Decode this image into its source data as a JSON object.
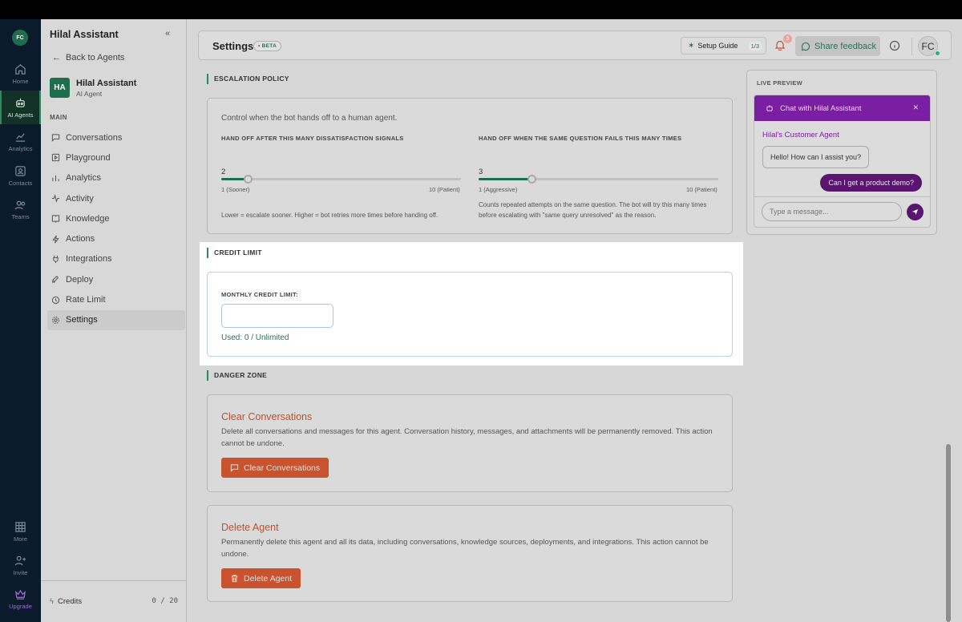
{
  "rail": {
    "avatar": "FC",
    "items": [
      {
        "label": "Home",
        "icon": "home-icon"
      },
      {
        "label": "AI Agents",
        "icon": "robot-icon"
      },
      {
        "label": "Analytics",
        "icon": "chart-icon"
      },
      {
        "label": "Contacts",
        "icon": "contacts-icon"
      },
      {
        "label": "Teams",
        "icon": "teams-icon"
      },
      {
        "label": "More",
        "icon": "grid-icon"
      },
      {
        "label": "Invite",
        "icon": "user-plus-icon"
      },
      {
        "label": "Upgrade",
        "icon": "crown-icon"
      }
    ]
  },
  "sidebar": {
    "title": "Hilal Assistant",
    "back": "Back to Agents",
    "agent": {
      "initials": "HA",
      "name": "Hilal Assistant",
      "type": "AI Agent"
    },
    "section": "MAIN",
    "items": [
      {
        "label": "Conversations"
      },
      {
        "label": "Playground"
      },
      {
        "label": "Analytics"
      },
      {
        "label": "Activity"
      },
      {
        "label": "Knowledge"
      },
      {
        "label": "Actions"
      },
      {
        "label": "Integrations"
      },
      {
        "label": "Deploy"
      },
      {
        "label": "Rate Limit"
      },
      {
        "label": "Settings"
      }
    ],
    "credits_label": "Credits",
    "credits_value": "0 / 20"
  },
  "header": {
    "title": "Settings",
    "badge": "• BETA",
    "setup_label": "Setup Guide",
    "setup_step": "1/3",
    "notification_count": "3",
    "feedback_label": "Share feedback",
    "avatar": "FC"
  },
  "escalation": {
    "heading": "ESCALATION POLICY",
    "description": "Control when the bot hands off to a human agent.",
    "slider1": {
      "label": "HAND OFF AFTER THIS MANY DISSATISFACTION SIGNALS",
      "value": "2",
      "min_label": "1 (Sooner)",
      "max_label": "10 (Patient)",
      "hint": "Lower = escalate sooner. Higher = bot retries more times before handing off.",
      "fraction": 0.111
    },
    "slider2": {
      "label": "HAND OFF WHEN THE SAME QUESTION FAILS THIS MANY TIMES",
      "value": "3",
      "min_label": "1 (Aggressive)",
      "max_label": "10 (Patient)",
      "hint": "Counts repeated attempts on the same question. The bot will try this many times before escalating with \"same query unresolved\" as the reason.",
      "fraction": 0.222
    }
  },
  "credit": {
    "heading": "CREDIT LIMIT",
    "label": "MONTHLY CREDIT LIMIT:",
    "input_value": "",
    "used": "Used: 0 / Unlimited"
  },
  "danger": {
    "heading": "DANGER ZONE",
    "clear": {
      "title": "Clear Conversations",
      "description": "Delete all conversations and messages for this agent. Conversation history, messages, and attachments will be permanently removed. This action cannot be undone.",
      "button": "Clear Conversations"
    },
    "delete": {
      "title": "Delete Agent",
      "description": "Permanently delete this agent and all its data, including conversations, knowledge sources, deployments, and integrations. This action cannot be undone.",
      "button": "Delete Agent"
    }
  },
  "preview": {
    "label": "LIVE PREVIEW",
    "chat_title": "Chat with Hilal Assistant",
    "agent_name": "Hilal's Customer Agent",
    "bot_message": "Hello! How can I assist you?",
    "user_message": "Can I get a product demo?",
    "input_placeholder": "Type a message..."
  },
  "colors": {
    "accent_green": "#1f6d4e",
    "danger": "#c9532e",
    "chat_purple": "#7a1fa2"
  }
}
